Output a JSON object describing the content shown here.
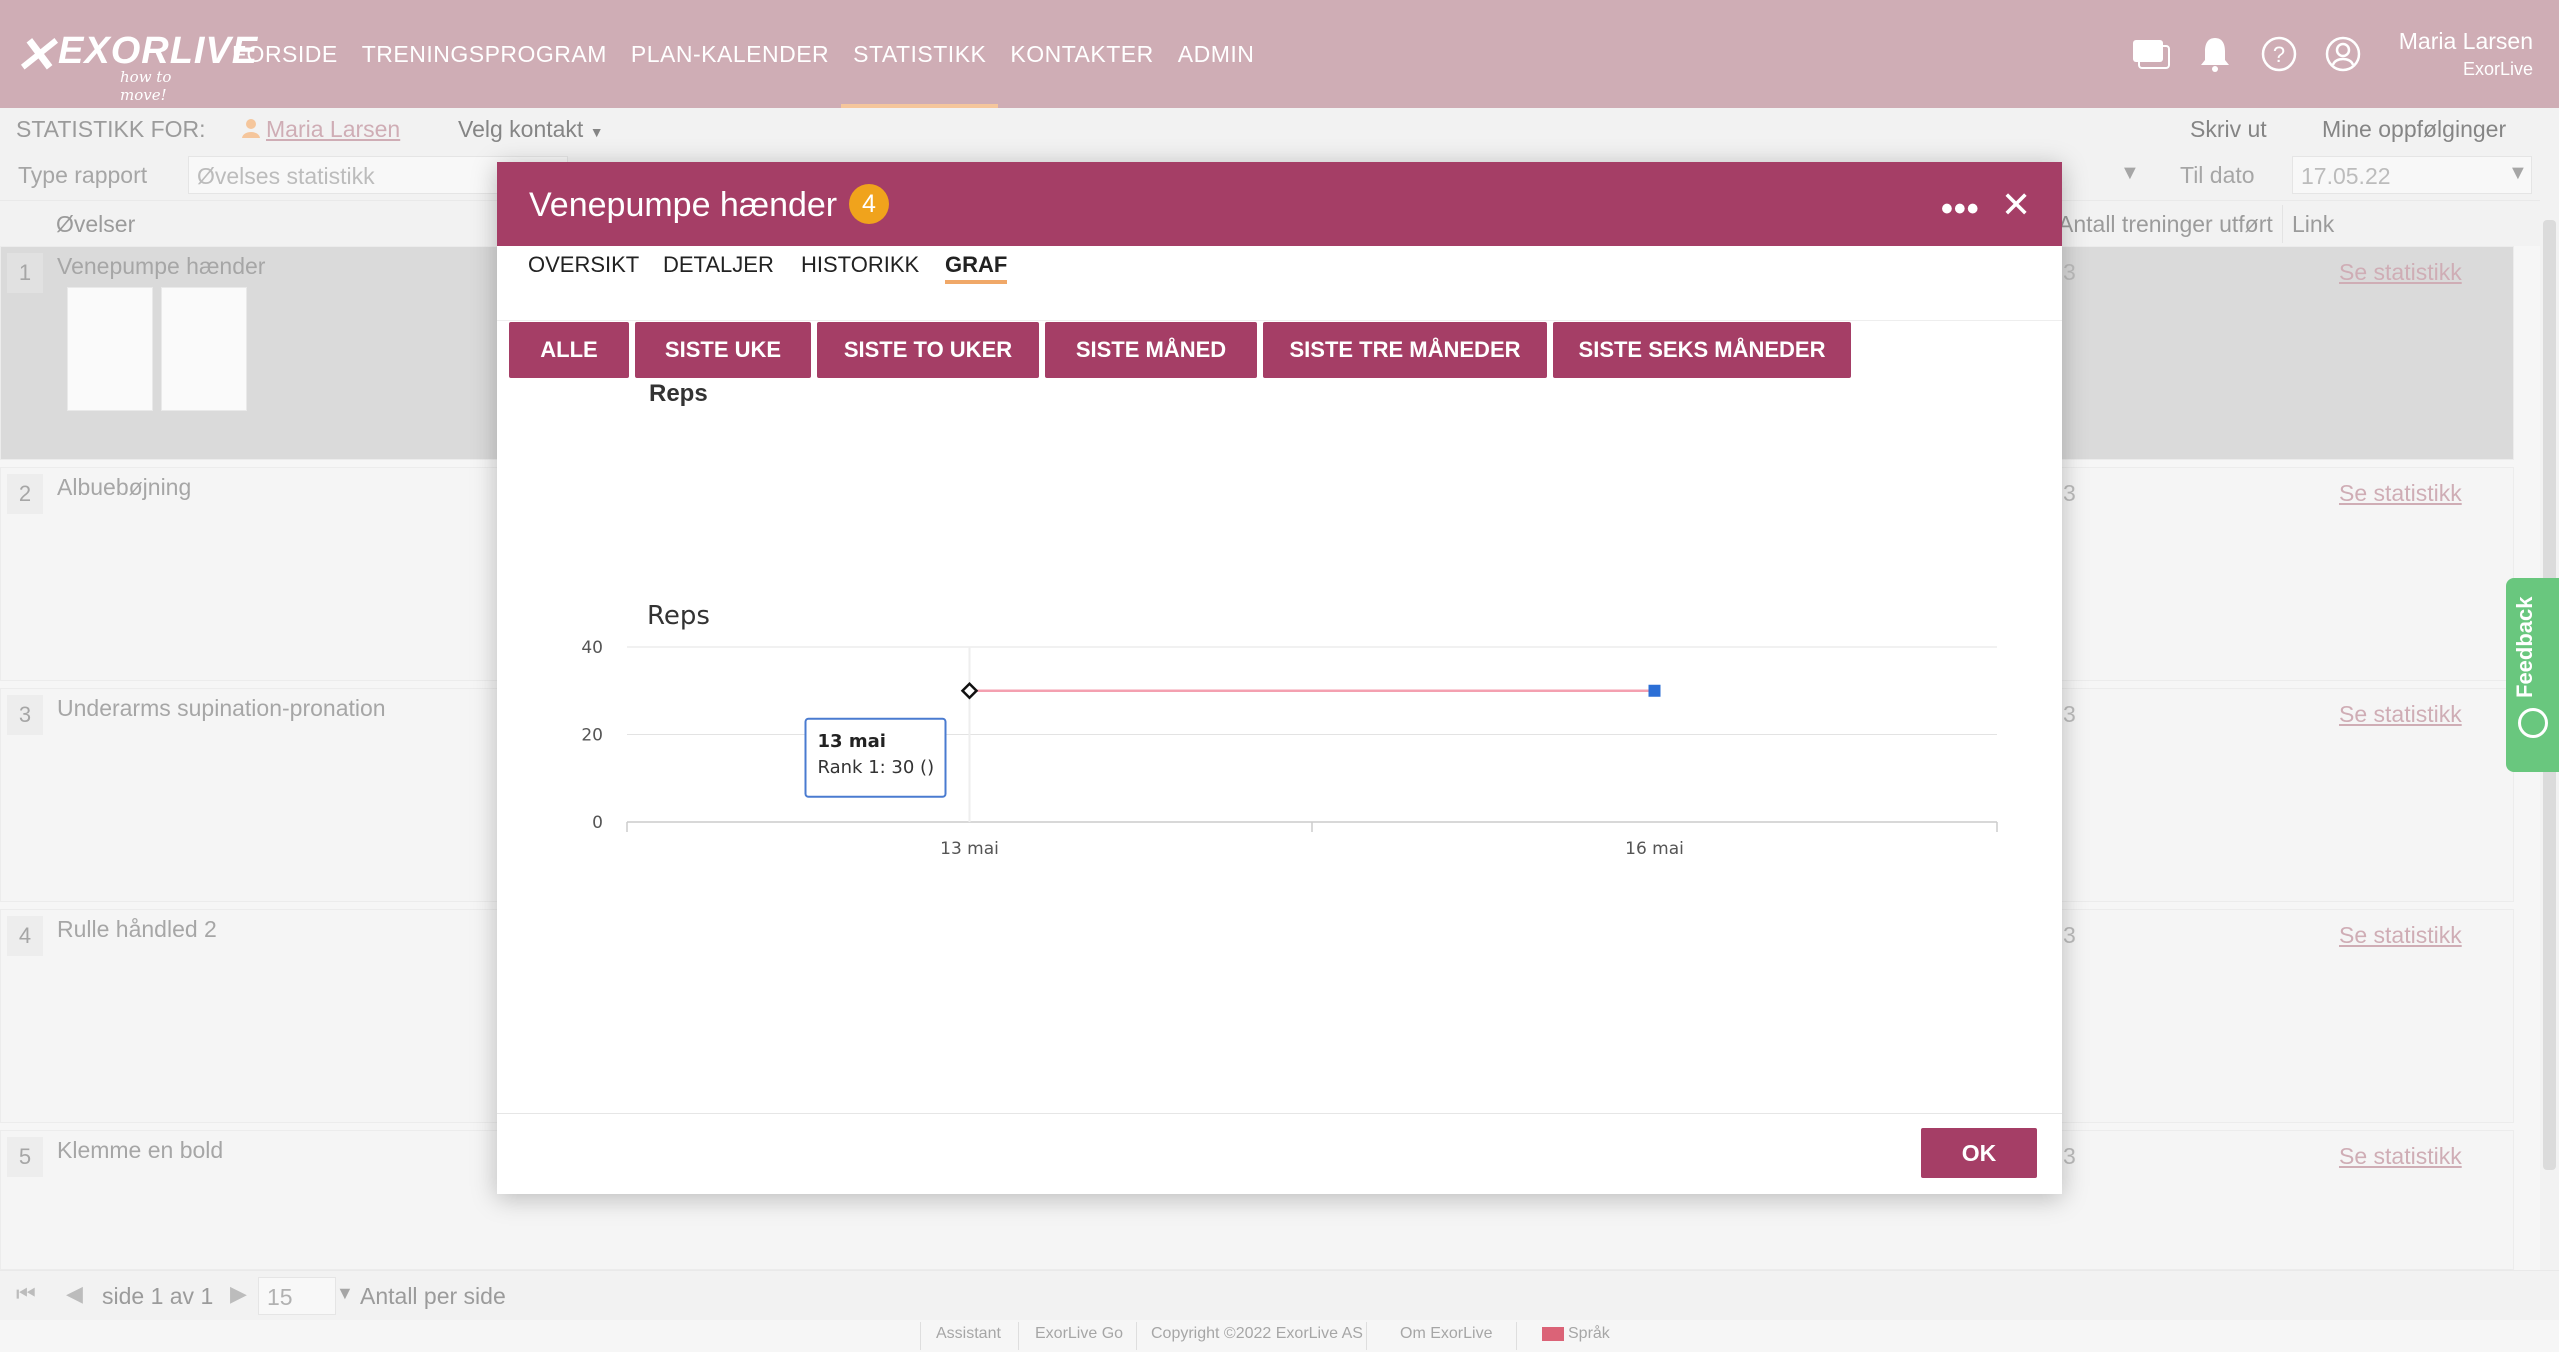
{
  "header": {
    "logo_word": "EXORLIVE",
    "logo_tagline": "how to move!",
    "nav": [
      {
        "label": "FORSIDE",
        "active": false
      },
      {
        "label": "TRENINGSPROGRAM",
        "active": false
      },
      {
        "label": "PLAN-KALENDER",
        "active": false
      },
      {
        "label": "STATISTIKK",
        "active": true
      },
      {
        "label": "KONTAKTER",
        "active": false
      },
      {
        "label": "ADMIN",
        "active": false
      }
    ],
    "icons": [
      "chat-icon",
      "bell-icon",
      "help-icon",
      "user-icon"
    ],
    "user_name": "Maria Larsen",
    "user_org": "ExorLive"
  },
  "subbar": {
    "statistics_for_label": "STATISTIKK FOR:",
    "person": "Maria Larsen",
    "choose_contact": "Velg kontakt",
    "print": "Skriv ut",
    "my_followups": "Mine oppfølginger",
    "report_type_label": "Type rapport",
    "report_type_value": "Øvelses statistikk",
    "to_date_label": "Til dato",
    "to_date_value": "17.05.22"
  },
  "grid": {
    "col_exercises": "Øvelser",
    "col_count": "Antall treninger utført",
    "col_link": "Link",
    "rows": [
      {
        "num": "1",
        "name": "Venepumpe hænder",
        "count": "3",
        "link": "Se statistikk",
        "selected": true
      },
      {
        "num": "2",
        "name": "Albuebøjning",
        "count": "3",
        "link": "Se statistikk",
        "selected": false
      },
      {
        "num": "3",
        "name": "Underarms supination-pronation",
        "count": "3",
        "link": "Se statistikk",
        "selected": false
      },
      {
        "num": "4",
        "name": "Rulle håndled 2",
        "count": "3",
        "link": "Se statistikk",
        "selected": false
      },
      {
        "num": "5",
        "name": "Klemme en bold",
        "count": "3",
        "link": "Se statistikk",
        "selected": false
      }
    ]
  },
  "feedback": "Feedback",
  "pager": {
    "page_text": "side 1 av 1",
    "per_page": "15",
    "per_page_label": "Antall per side"
  },
  "footer": [
    "Assistant",
    "ExorLive Go",
    "Copyright ©2022 ExorLive AS",
    "Om ExorLive",
    "Språk"
  ],
  "modal": {
    "title": "Venepumpe hænder",
    "badge": "4",
    "tabs": [
      {
        "label": "OVERSIKT",
        "active": false
      },
      {
        "label": "DETALJER",
        "active": false
      },
      {
        "label": "HISTORIKK",
        "active": false
      },
      {
        "label": "GRAF",
        "active": true
      }
    ],
    "filters": [
      "ALLE",
      "SISTE UKE",
      "SISTE TO UKER",
      "SISTE MÅNED",
      "SISTE TRE MÅNEDER",
      "SISTE SEKS MÅNEDER"
    ],
    "chart_heading": "Reps",
    "ok": "OK",
    "tooltip": {
      "date": "13 mai",
      "text": "Rank 1: 30 ()"
    }
  },
  "chart_data": {
    "type": "line",
    "title": "Reps",
    "x": [
      "13 mai",
      "16 mai"
    ],
    "series": [
      {
        "name": "Rank 1",
        "values": [
          30,
          30
        ]
      }
    ],
    "xlabel": "",
    "ylabel": "",
    "ylim": [
      0,
      40
    ],
    "yticks": [
      0,
      20,
      40
    ],
    "grid": true,
    "colors": {
      "line": "#f4a0b0",
      "marker_end": "#2c6fd6"
    }
  }
}
